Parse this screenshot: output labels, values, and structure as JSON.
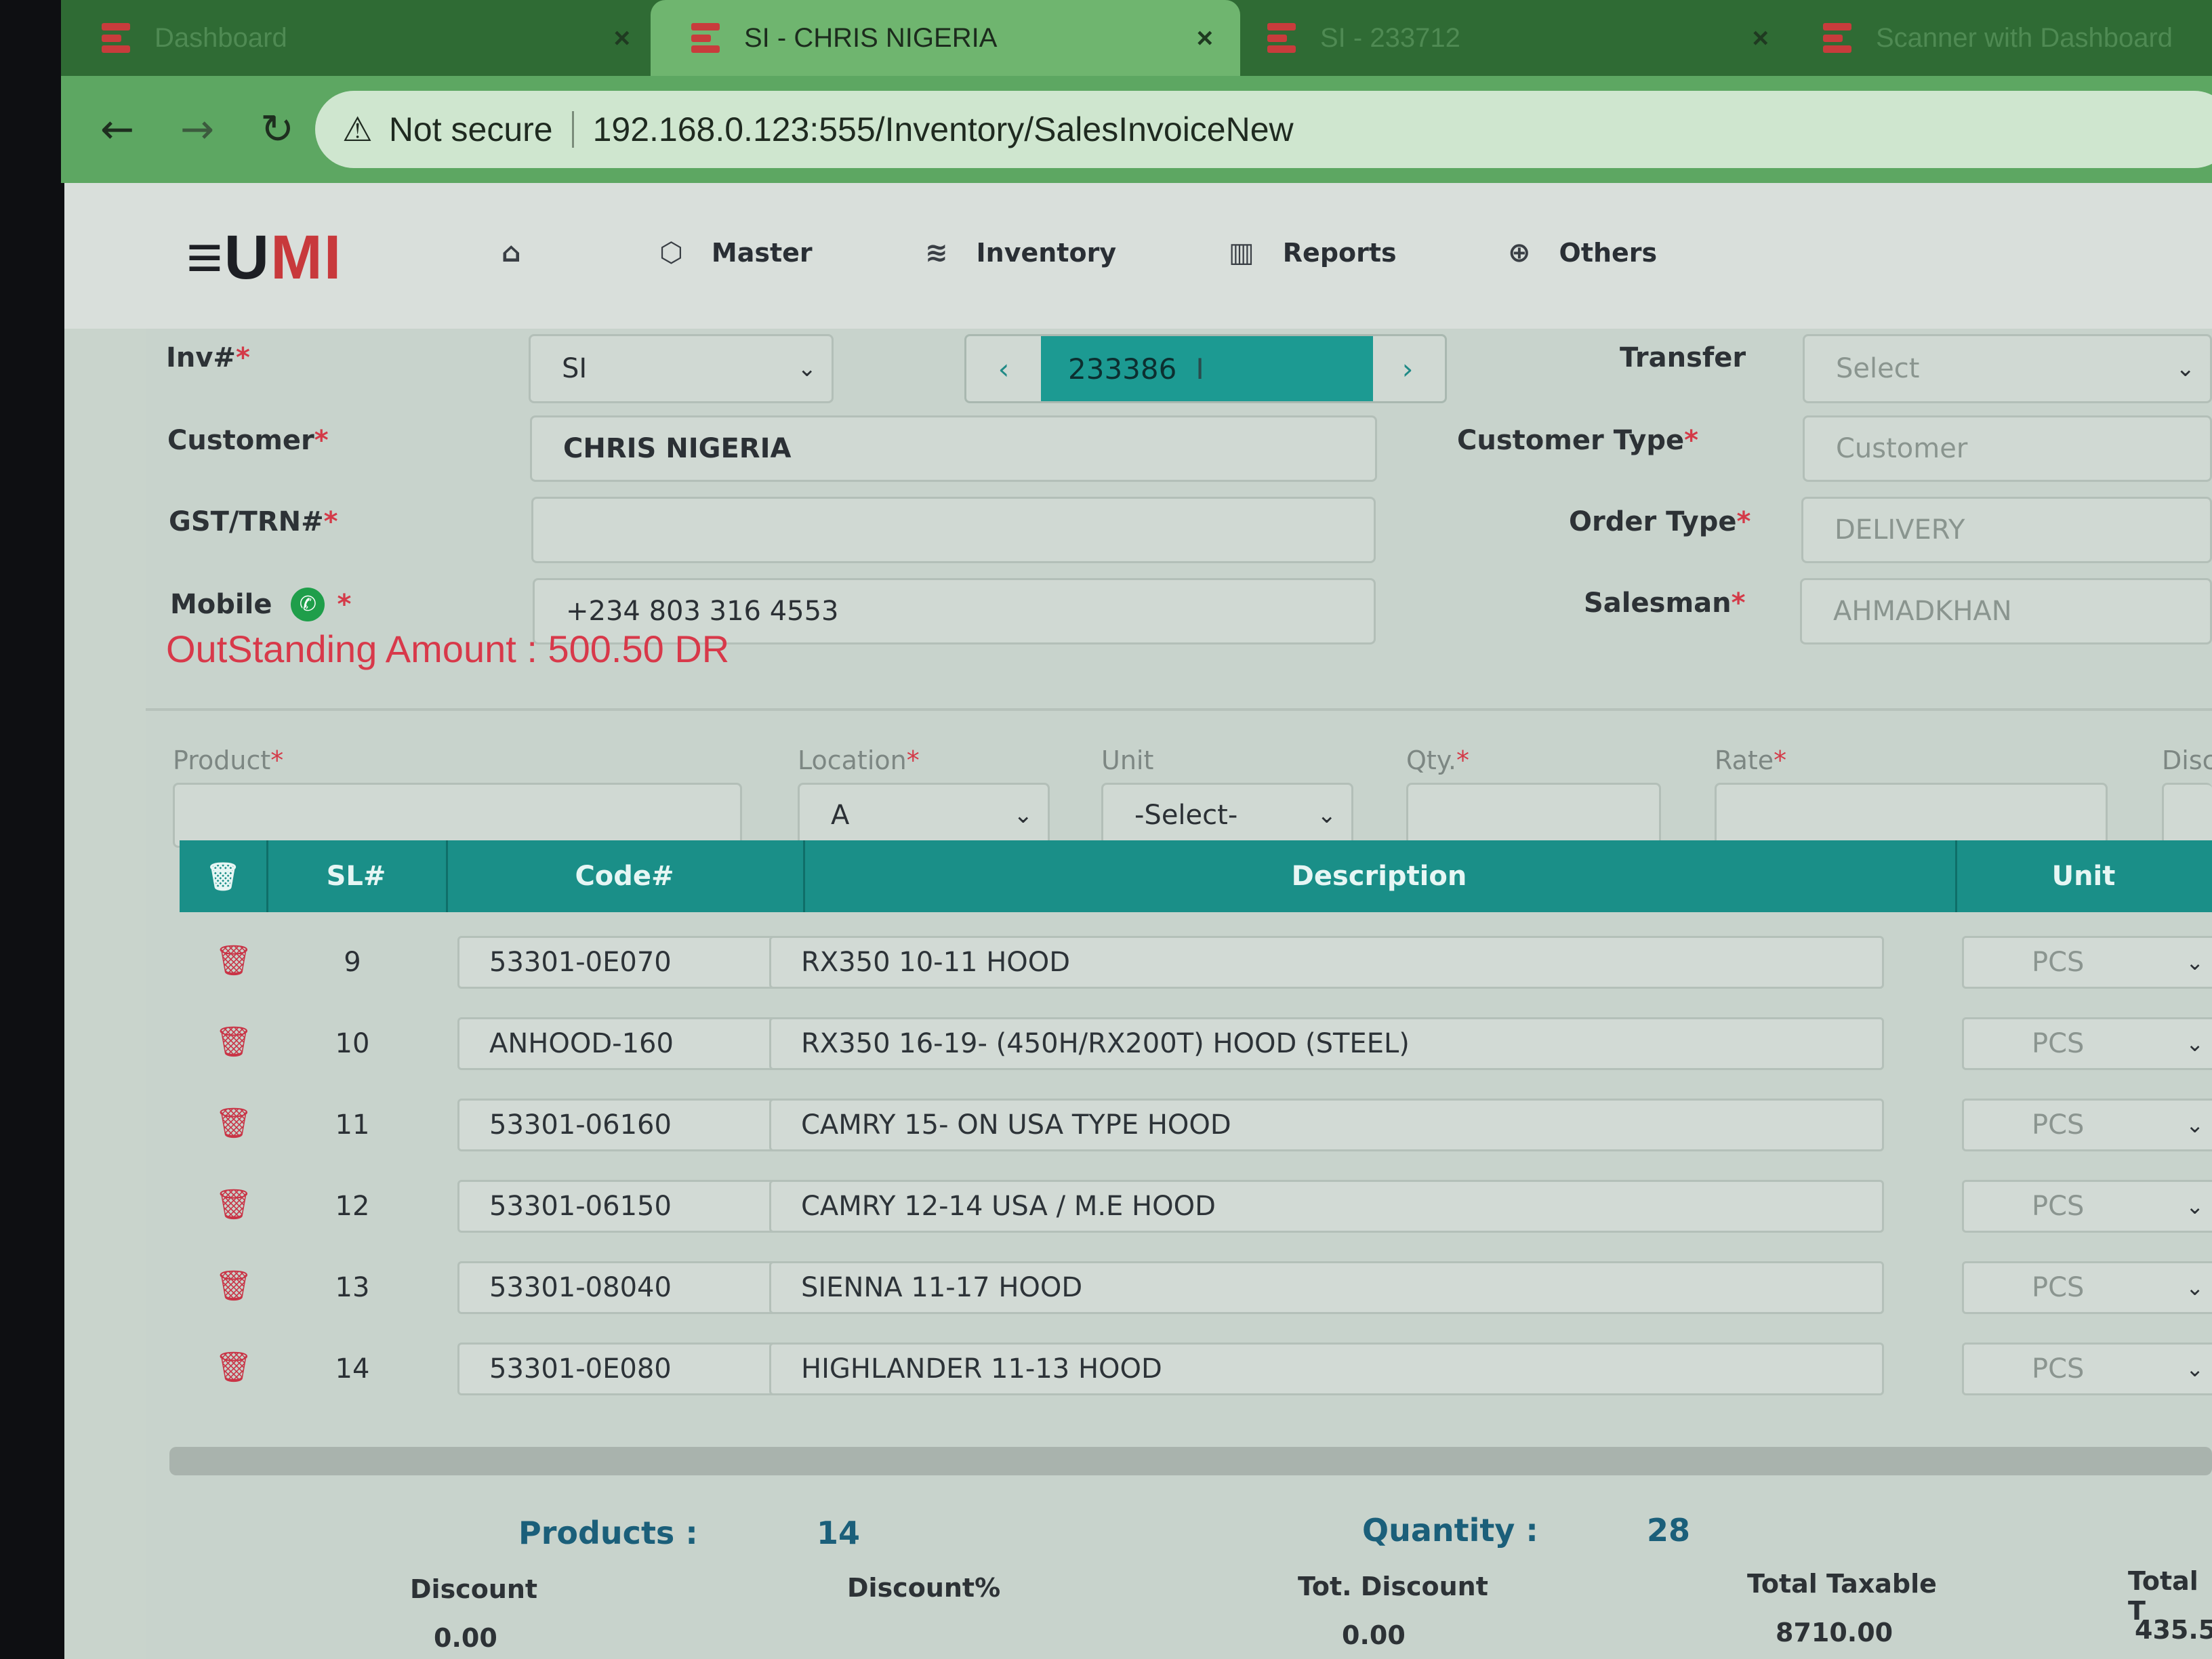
{
  "browser": {
    "tabs": [
      {
        "title": "Dashboard",
        "active": false
      },
      {
        "title": "SI - CHRIS NIGERIA",
        "active": true
      },
      {
        "title": "SI - 233712",
        "active": false
      },
      {
        "title": "Scanner with Dashboard",
        "active": false
      }
    ],
    "address": {
      "security_label": "Not secure",
      "url": "192.168.0.123:555/Inventory/SalesInvoiceNew"
    }
  },
  "app": {
    "logo": {
      "part1": "≡U",
      "part2": "MI"
    },
    "nav": [
      {
        "label": "",
        "icon": "home-icon"
      },
      {
        "label": "Master",
        "icon": "cube-icon"
      },
      {
        "label": "Inventory",
        "icon": "layers-icon"
      },
      {
        "label": "Reports",
        "icon": "bar-chart-icon"
      },
      {
        "label": "Others",
        "icon": "globe-icon"
      }
    ]
  },
  "form": {
    "inv_label": "Inv#",
    "inv_prefix": "SI",
    "inv_number": "233386",
    "transfer_label": "Transfer",
    "transfer_value": "Select",
    "customer_label": "Customer",
    "customer_value": "CHRIS NIGERIA",
    "customer_type_label": "Customer Type",
    "customer_type_value": "Customer",
    "gst_label": "GST/TRN#",
    "gst_value": "",
    "order_type_label": "Order Type",
    "order_type_value": "DELIVERY",
    "mobile_label": "Mobile",
    "mobile_value": "+234 803 316 4553",
    "salesman_label": "Salesman",
    "salesman_value": "AHMADKHAN",
    "outstanding": "OutStanding Amount : 500.50 DR"
  },
  "item_entry": {
    "product_label": "Product",
    "location_label": "Location",
    "location_value": "A",
    "unit_label": "Unit",
    "unit_value": "-Select-",
    "qty_label": "Qty.",
    "rate_label": "Rate",
    "disc_label": "Disc"
  },
  "table": {
    "columns": [
      "SL#",
      "Code#",
      "Description",
      "Unit"
    ],
    "rows": [
      {
        "sl": "9",
        "code": "53301-0E070",
        "description": "RX350 10-11 HOOD",
        "unit": "PCS"
      },
      {
        "sl": "10",
        "code": "ANHOOD-160",
        "description": "RX350 16-19- (450H/RX200T) HOOD (STEEL)",
        "unit": "PCS"
      },
      {
        "sl": "11",
        "code": "53301-06160",
        "description": "CAMRY 15- ON USA TYPE HOOD",
        "unit": "PCS"
      },
      {
        "sl": "12",
        "code": "53301-06150",
        "description": "CAMRY 12-14 USA / M.E HOOD",
        "unit": "PCS"
      },
      {
        "sl": "13",
        "code": "53301-08040",
        "description": "SIENNA 11-17 HOOD",
        "unit": "PCS"
      },
      {
        "sl": "14",
        "code": "53301-0E080",
        "description": "HIGHLANDER 11-13 HOOD",
        "unit": "PCS"
      }
    ]
  },
  "summary": {
    "products_label": "Products :",
    "products_value": "14",
    "quantity_label": "Quantity :",
    "quantity_value": "28"
  },
  "totals": [
    {
      "label": "Discount",
      "value": "0.00"
    },
    {
      "label": "Discount%",
      "value": ""
    },
    {
      "label": "Tot. Discount",
      "value": "0.00"
    },
    {
      "label": "Total Taxable",
      "value": "8710.00"
    },
    {
      "label": "Total T",
      "value": "435.5"
    }
  ],
  "colors": {
    "accent": "#1a8f88",
    "brand_red": "#c8393c",
    "alert": "#d8394a"
  }
}
